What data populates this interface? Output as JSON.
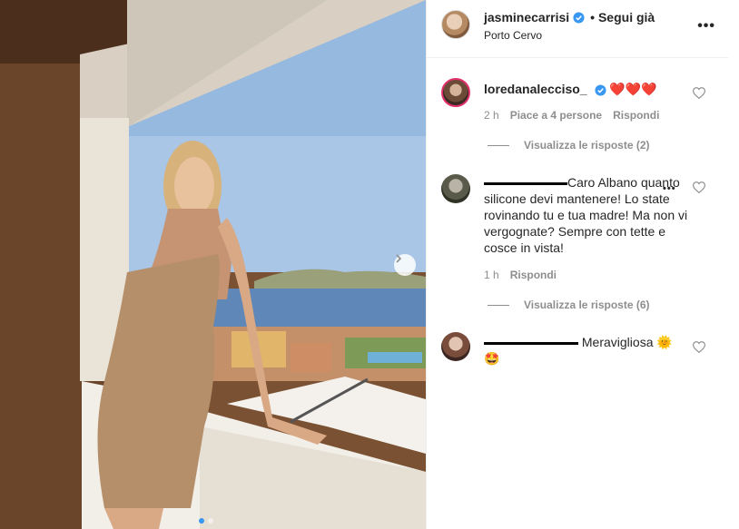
{
  "post": {
    "username": "jasminecarrisi",
    "follow_status": "• Segui già",
    "location": "Porto Cervo",
    "more_label": "•••"
  },
  "comments": [
    {
      "username": "loredanalecciso_",
      "text": "❤️❤️❤️",
      "time": "2 h",
      "likes": "Piace a 4 persone",
      "reply_label": "Rispondi",
      "view_replies": "Visualizza le risposte (2)"
    },
    {
      "username": "",
      "text": "Caro Albano quanto silicone devi mantenere! Lo state rovinando tu e tua madre! Ma non vi vergognate? Sempre con tette e cosce in vista!",
      "time": "1 h",
      "reply_label": "Rispondi",
      "view_replies": "Visualizza le risposte (6)",
      "more_label": "•••"
    },
    {
      "username": "",
      "text": "Meravigliosa 🌞",
      "text2": "🤩"
    }
  ],
  "icons": {
    "verified": "verified-badge-icon",
    "heart": "heart-outline-icon",
    "arrow": "chevron-right-icon"
  },
  "colors": {
    "verified_blue": "#3897f0",
    "muted": "#8e8e8e",
    "text": "#262626"
  }
}
